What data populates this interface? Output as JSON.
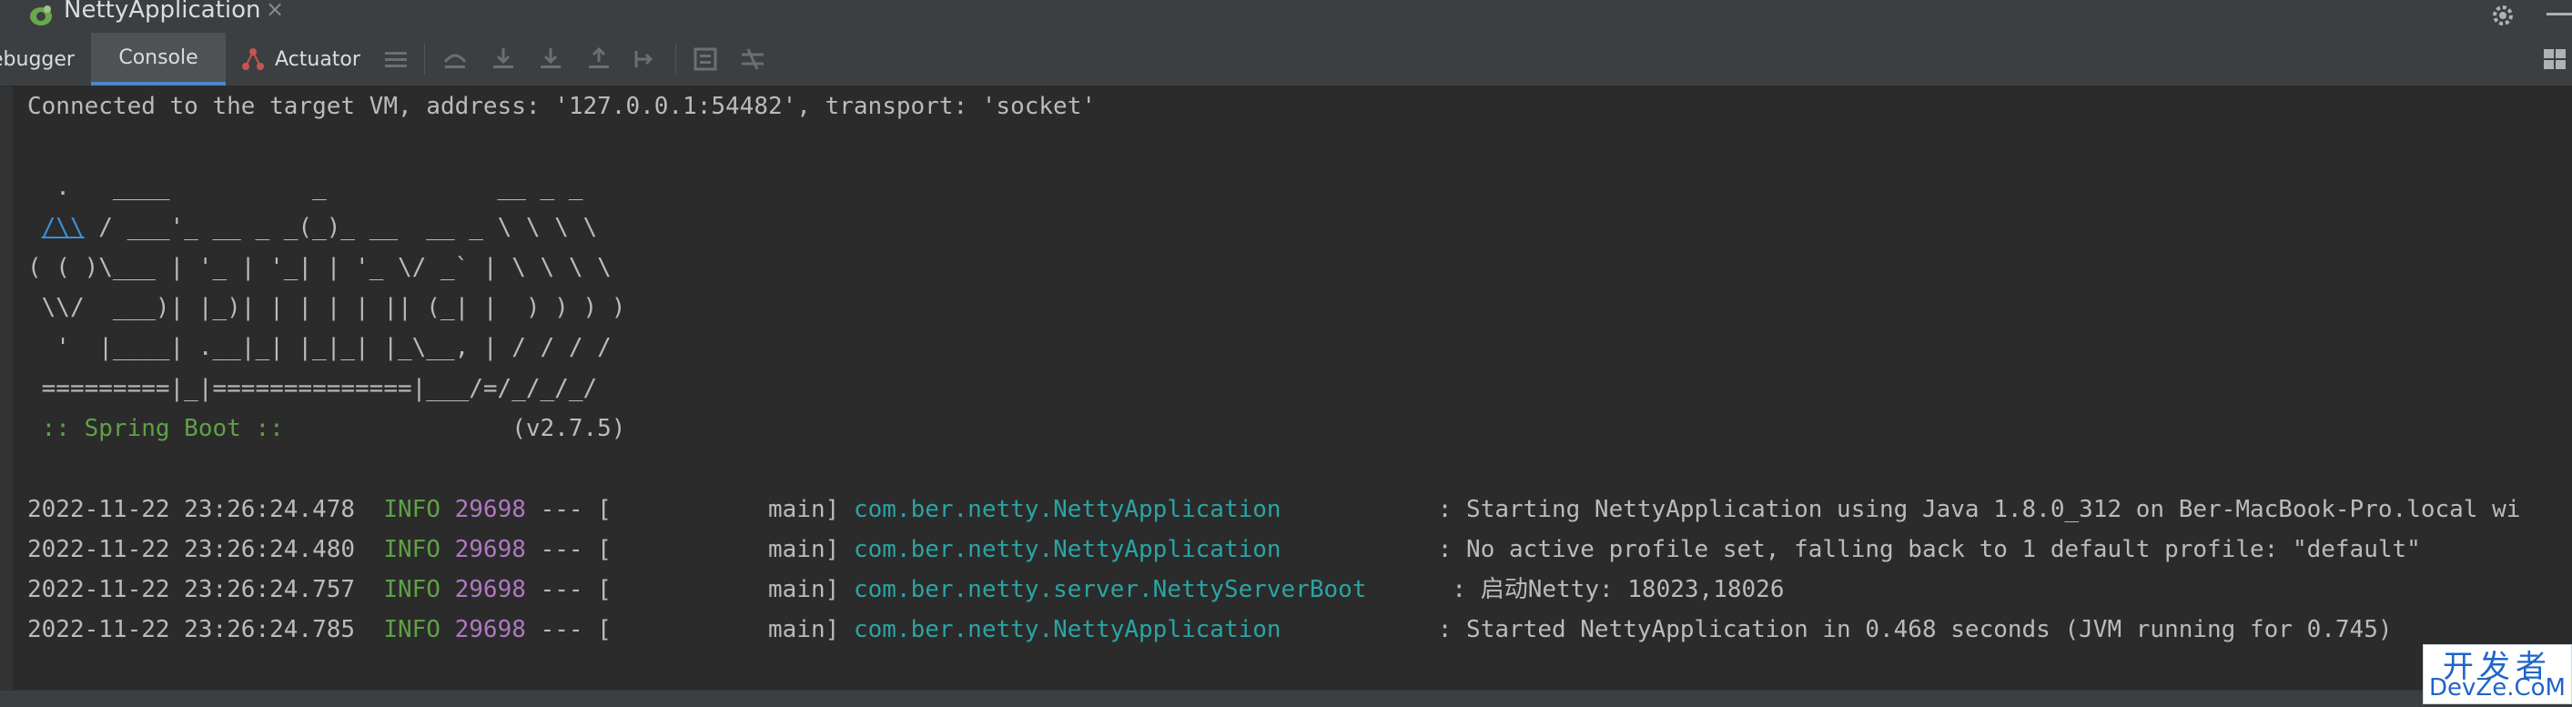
{
  "run_tab": {
    "label": "NettyApplication",
    "close": "×"
  },
  "toolbar": {
    "tabs": [
      {
        "label": "ebugger"
      },
      {
        "label": "Console"
      },
      {
        "label": "Actuator"
      }
    ]
  },
  "console": {
    "connected": "Connected to the target VM, address: '127.0.0.1:54482', transport: 'socket'",
    "banner": [
      "  .   ____          _            __ _ _",
      " /\\\\ / ___'_ __ _ _(_)_ __  __ _ \\ \\ \\ \\",
      "( ( )\\___ | '_ | '_| | '_ \\/ _` | \\ \\ \\ \\",
      " \\\\/  ___)| |_)| | | | | || (_| |  ) ) ) )",
      "  '  |____| .__|_| |_|_| |_\\__, | / / / /",
      " =========|_|==============|___/=/_/_/_/"
    ],
    "banner_link": "/\\\\",
    "spring_label": " :: Spring Boot :: ",
    "spring_version": "               (v2.7.5)",
    "logs": [
      {
        "timestamp": "2022-11-22 23:26:24.478",
        "level": "INFO",
        "pid": "29698",
        "sep": "--- [",
        "thread": "           main]",
        "logger": "com.ber.netty.NettyApplication          ",
        "message": " : Starting NettyApplication using Java 1.8.0_312 on Ber-MacBook-Pro.local wi"
      },
      {
        "timestamp": "2022-11-22 23:26:24.480",
        "level": "INFO",
        "pid": "29698",
        "sep": "--- [",
        "thread": "           main]",
        "logger": "com.ber.netty.NettyApplication          ",
        "message": " : No active profile set, falling back to 1 default profile: \"default\""
      },
      {
        "timestamp": "2022-11-22 23:26:24.757",
        "level": "INFO",
        "pid": "29698",
        "sep": "--- [",
        "thread": "           main]",
        "logger": "com.ber.netty.server.NettyServerBoot     ",
        "message": " : 启动Netty: 18023,18026"
      },
      {
        "timestamp": "2022-11-22 23:26:24.785",
        "level": "INFO",
        "pid": "29698",
        "sep": "--- [",
        "thread": "           main]",
        "logger": "com.ber.netty.NettyApplication          ",
        "message": " : Started NettyApplication in 0.468 seconds (JVM running for 0.745)"
      }
    ]
  },
  "colors": {
    "background": "#2b2b2b",
    "info": "#5fa146",
    "pid": "#b077c2",
    "logger": "#2ba4a4",
    "accent": "#4a88c7"
  },
  "watermark": {
    "top": "开发者",
    "bottom": "DevZe.CoM"
  }
}
